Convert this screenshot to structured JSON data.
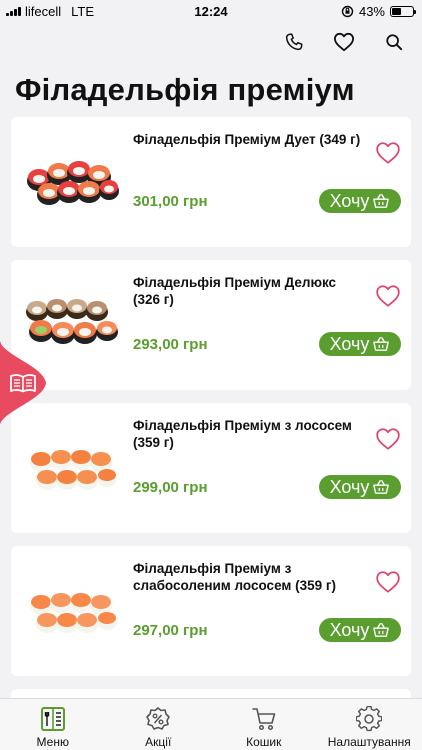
{
  "status_bar": {
    "carrier": "lifecell",
    "network": "LTE",
    "time": "12:24",
    "battery": "43%",
    "battery_level": 0.43
  },
  "header": {
    "icons": [
      "phone-icon",
      "heart-icon",
      "search-icon"
    ]
  },
  "page": {
    "title": "Філадельфія преміум"
  },
  "colors": {
    "accent": "#5a9e2f",
    "favorite": "#e0426a",
    "side_tab": "#e84a5f"
  },
  "products": [
    {
      "name": "Філадельфія Преміум Дует (349 г)",
      "price": "301,00 грн",
      "button": "Хочу"
    },
    {
      "name": "Філадельфія Преміум Делюкс (326 г)",
      "price": "293,00 грн",
      "button": "Хочу"
    },
    {
      "name": "Філадельфія Преміум з лососем (359 г)",
      "price": "299,00 грн",
      "button": "Хочу"
    },
    {
      "name": "Філадельфія Преміум з слабосоленим лососем (359 г)",
      "price": "297,00 грн",
      "button": "Хочу"
    }
  ],
  "tab_bar": {
    "tabs": [
      {
        "label": "Меню",
        "icon": "menu-book-icon",
        "active": true
      },
      {
        "label": "Акції",
        "icon": "discount-badge-icon",
        "active": false
      },
      {
        "label": "Кошик",
        "icon": "cart-icon",
        "active": false
      },
      {
        "label": "Налаштування",
        "icon": "gear-icon",
        "active": false
      }
    ]
  }
}
